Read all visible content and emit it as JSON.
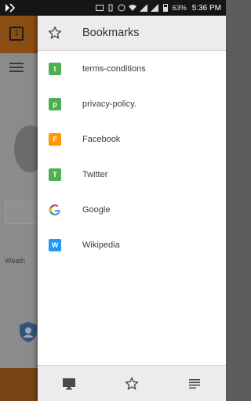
{
  "status_bar": {
    "battery_percent": "63%",
    "time": "5:36 PM"
  },
  "background_app": {
    "tab_count": "1",
    "weather_label": "Weath"
  },
  "drawer": {
    "title": "Bookmarks",
    "items": [
      {
        "letter": "t",
        "label": "terms-conditions",
        "color": "#4caf50"
      },
      {
        "letter": "p",
        "label": "privacy-policy.",
        "color": "#4caf50"
      },
      {
        "letter": "F",
        "label": "Facebook",
        "color": "#ff9800"
      },
      {
        "letter": "T",
        "label": "Twitter",
        "color": "#4caf50"
      },
      {
        "letter": "G",
        "label": "Google",
        "color": "#4285f4"
      },
      {
        "letter": "W",
        "label": "Wikipedia",
        "color": "#2196f3"
      }
    ],
    "footer": [
      "desktop-icon",
      "star-icon",
      "reading-list-icon"
    ]
  }
}
